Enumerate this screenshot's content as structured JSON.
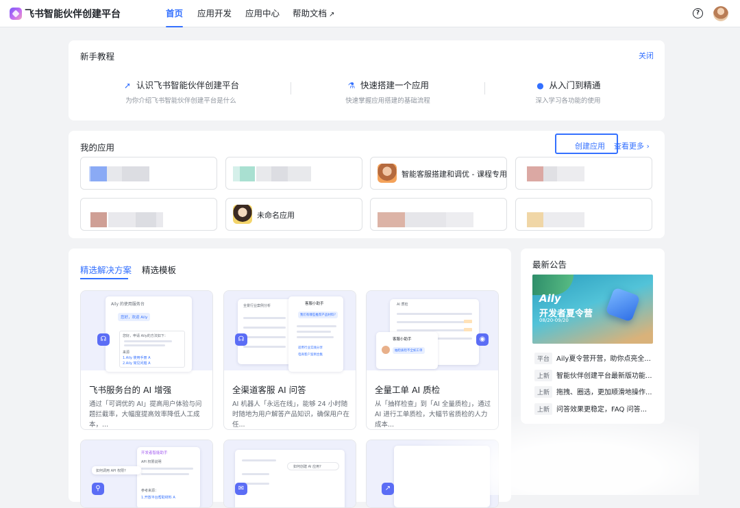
{
  "header": {
    "brand": "飞书智能伙伴创建平台",
    "nav": [
      "首页",
      "应用开发",
      "应用中心",
      "帮助文档"
    ],
    "help_glyph": "?"
  },
  "tutorial": {
    "title": "新手教程",
    "close": "关闭",
    "items": [
      {
        "title": "认识飞书智能伙伴创建平台",
        "subtitle": "为你介绍飞书智能伙伴创建平台是什么",
        "icon": "rocket-icon"
      },
      {
        "title": "快速搭建一个应用",
        "subtitle": "快速掌握应用搭建的基础流程",
        "icon": "flask-icon"
      },
      {
        "title": "从入门到精通",
        "subtitle": "深入学习各功能的使用",
        "icon": "map-pin-icon"
      }
    ]
  },
  "apps": {
    "title": "我的应用",
    "create": "创建应用",
    "more": "查看更多",
    "named": [
      "智能客服搭建和调优 - 课程专用",
      "未命名应用"
    ]
  },
  "solutions": {
    "tabs": [
      "精选解决方案",
      "精选模板"
    ],
    "items": [
      {
        "title": "飞书服务台的 AI 增强",
        "desc": "通过「可调优的 AI」提高用户体验与问题拦截率，大幅度提高效率降低人工成本，..."
      },
      {
        "title": "全渠道客服 AI 问答",
        "desc": "AI 机器人「永远在线」，能够 24 小时随时随地为用户解答产品知识，确保用户在任..."
      },
      {
        "title": "全量工单 AI 质检",
        "desc": "从「抽样检查」到「AI 全量质检」，通过 AI 进行工单质检，大幅节省质检的人力成本..."
      }
    ],
    "mock_text": {
      "s1_header": "Aily 的使用服务台",
      "s1_chat": "您好，欢迎 Aily",
      "s1_reply": "您好，申请 Aily的方法如下：",
      "s1_src": "来源",
      "s1_link1": "1.Aily 使用手册 A",
      "s1_link2": "2.Aily 常见问题 A",
      "s2_header": "客服小助手",
      "s2_q": "我们有哪些推荐产品材料?",
      "s2_left": "全景行业案例分析",
      "s2_l1": "适用行业实践分享",
      "s2_l2": "电商客户案例合集",
      "s3_header": "AI 质检",
      "s3_bot": "客服小助手",
      "s3_q": "抽检质检不全如工单",
      "s4_header": "开发者智能助手",
      "s4_sub": "API 权限说明",
      "s4_q": "如何调用 API 权限?",
      "s4_ref": "参考来源：",
      "s4_ref1": "1.开放平台帮助材料 A",
      "s5_q": "如何创建 AI 应用?"
    }
  },
  "announcements": {
    "title": "最新公告",
    "banner": {
      "line1": "Aily",
      "line2": "开发者夏令营",
      "line3": "08/20-09/20"
    },
    "items": [
      {
        "tag": "平台",
        "text": "Aily夏令营开营，助你点亮全..."
      },
      {
        "tag": "上新",
        "text": "智能伙伴创建平台最新版功能..."
      },
      {
        "tag": "上新",
        "text": "拖拽、圈选，更加顺滑地操作..."
      },
      {
        "tag": "上新",
        "text": "问答效果更稳定，FAQ 问答..."
      }
    ]
  },
  "colors": {
    "accent": "#3370ff",
    "background": "#f2f3f5"
  }
}
